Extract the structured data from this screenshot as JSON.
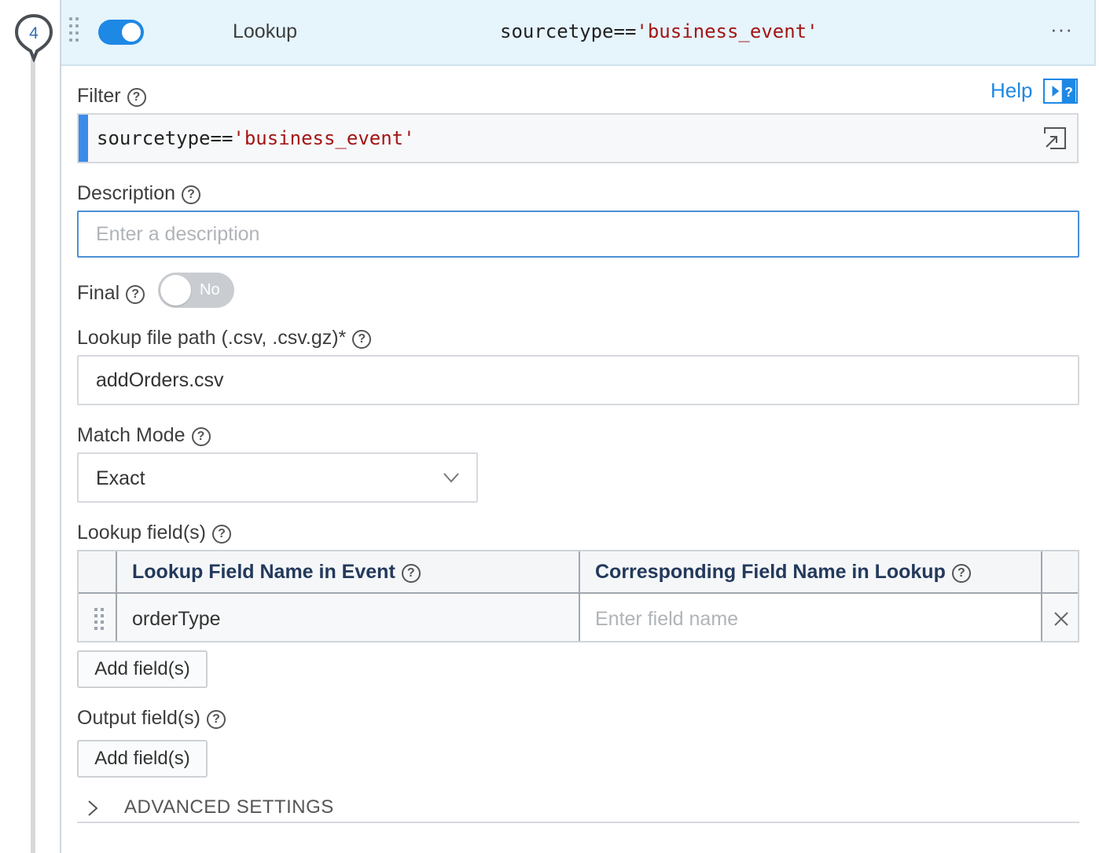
{
  "step": {
    "number": "4"
  },
  "header": {
    "enabled": true,
    "function_name": "Lookup",
    "filter_code": "sourcetype==",
    "filter_string": "'business_event'",
    "more_icon": "more-horizontal-icon"
  },
  "help": {
    "label": "Help",
    "icon": "help-panel-icon"
  },
  "filter": {
    "label": "Filter",
    "code": "sourcetype==",
    "string": "'business_event'"
  },
  "description": {
    "label": "Description",
    "value": "",
    "placeholder": "Enter a description"
  },
  "final": {
    "label": "Final",
    "state": "No",
    "on": false
  },
  "lookup_path": {
    "label": "Lookup file path (.csv, .csv.gz)*",
    "value": "addOrders.csv"
  },
  "match_mode": {
    "label": "Match Mode",
    "selected": "Exact"
  },
  "lookup_fields": {
    "label": "Lookup field(s)",
    "columns": [
      "Lookup Field Name in Event",
      "Corresponding Field Name in Lookup"
    ],
    "rows": [
      {
        "event_field": "orderType",
        "lookup_field": "",
        "lookup_placeholder": "Enter field name"
      }
    ],
    "add_label": "Add field(s)"
  },
  "output_fields": {
    "label": "Output field(s)",
    "add_label": "Add field(s)"
  },
  "advanced": {
    "label": "ADVANCED SETTINGS",
    "expanded": false
  },
  "colors": {
    "accent": "#1e88e5",
    "header_bg": "#e6f4fc",
    "string": "#a31515",
    "toggle_off": "#c9cdd1"
  }
}
